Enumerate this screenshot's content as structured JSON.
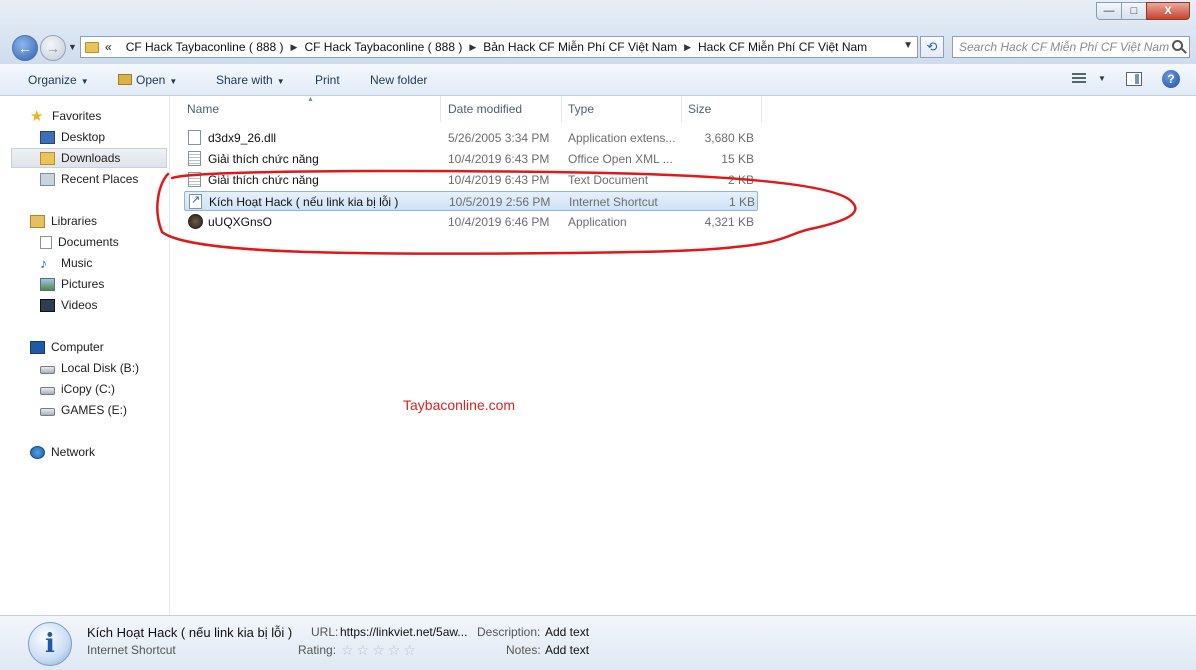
{
  "window": {
    "minimize": "—",
    "maximize": "□",
    "close": "X"
  },
  "address": {
    "overflow": "«",
    "crumbs": [
      "CF Hack Taybaconline ( 888 )",
      "CF Hack Taybaconline ( 888 )",
      "Bản Hack CF Miễn Phí CF Việt Nam",
      "Hack CF Miễn Phí CF Việt Nam"
    ],
    "separator": "▶",
    "search_placeholder": "Search Hack CF Miễn Phí CF Việt Nam"
  },
  "toolbar": {
    "organize": "Organize",
    "open": "Open",
    "share_with": "Share with",
    "print": "Print",
    "new_folder": "New folder",
    "help": "?"
  },
  "nav": {
    "favorites": "Favorites",
    "desktop": "Desktop",
    "downloads": "Downloads",
    "recent": "Recent Places",
    "libraries": "Libraries",
    "documents": "Documents",
    "music": "Music",
    "pictures": "Pictures",
    "videos": "Videos",
    "computer": "Computer",
    "disk_b": "Local Disk (B:)",
    "disk_c": "iCopy (C:)",
    "disk_e": "GAMES (E:)",
    "network": "Network"
  },
  "columns": {
    "name": "Name",
    "date": "Date modified",
    "type": "Type",
    "size": "Size"
  },
  "files": [
    {
      "name": "d3dx9_26.dll",
      "date": "5/26/2005 3:34 PM",
      "type": "Application extens...",
      "size": "3,680 KB"
    },
    {
      "name": "Giải thích chức năng",
      "date": "10/4/2019 6:43 PM",
      "type": "Office Open XML ...",
      "size": "15 KB"
    },
    {
      "name": "Giải thích chức năng",
      "date": "10/4/2019 6:43 PM",
      "type": "Text Document",
      "size": "2 KB"
    },
    {
      "name": "Kích Hoạt Hack ( nếu link kia bị lỗi )",
      "date": "10/5/2019 2:56 PM",
      "type": "Internet Shortcut",
      "size": "1 KB"
    },
    {
      "name": "uUQXGnsO",
      "date": "10/4/2019 6:46 PM",
      "type": "Application",
      "size": "4,321 KB"
    }
  ],
  "watermark": "Taybaconline.com",
  "details": {
    "name": "Kích Hoạt Hack ( nếu link kia bị lỗi )",
    "type": "Internet Shortcut",
    "url_label": "URL:",
    "url_value": "https://linkviet.net/5aw...",
    "desc_label": "Description:",
    "desc_value": "Add text",
    "rating_label": "Rating:",
    "rating_stars": "☆☆☆☆☆",
    "notes_label": "Notes:",
    "notes_value": "Add text"
  },
  "colors": {
    "annotation": "#e01818",
    "selection": "#cfe2f7"
  }
}
